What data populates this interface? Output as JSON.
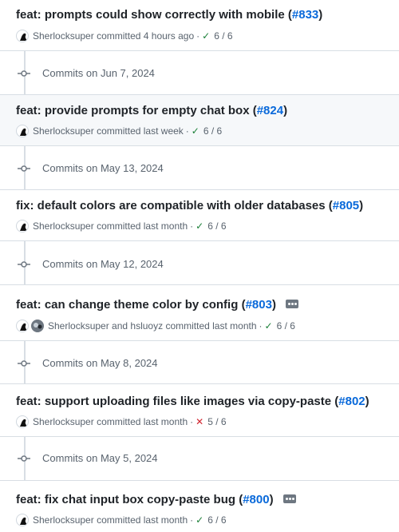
{
  "commits": [
    {
      "title": "feat: prompts could show correctly with mobile",
      "pr": "#833",
      "authors": "Sherlocksuper",
      "time": "4 hours ago",
      "status": "success",
      "checks": "6 / 6",
      "ellipsis": false
    },
    {
      "title": "feat: provide prompts for empty chat box",
      "pr": "#824",
      "authors": "Sherlocksuper",
      "time": "last week",
      "status": "success",
      "checks": "6 / 6",
      "ellipsis": false
    },
    {
      "title": "fix: default colors are compatible with older databases",
      "pr": "#805",
      "authors": "Sherlocksuper",
      "time": "last month",
      "status": "success",
      "checks": "6 / 6",
      "ellipsis": false
    },
    {
      "title": "feat: can change theme color by config",
      "pr": "#803",
      "authors": "Sherlocksuper and hsluoyz",
      "time": "last month",
      "status": "success",
      "checks": "6 / 6",
      "ellipsis": true
    },
    {
      "title": "feat: support uploading files like images via copy-paste",
      "pr": "#802",
      "authors": "Sherlocksuper",
      "time": "last month",
      "status": "failure",
      "checks": "5 / 6",
      "ellipsis": false
    },
    {
      "title": "feat: fix chat input box copy-paste bug",
      "pr": "#800",
      "authors": "Sherlocksuper",
      "time": "last month",
      "status": "success",
      "checks": "6 / 6",
      "ellipsis": true
    }
  ],
  "date_groups": [
    "Commits on Jun 7, 2024",
    "Commits on May 13, 2024",
    "Commits on May 12, 2024",
    "Commits on May 8, 2024",
    "Commits on May 5, 2024"
  ],
  "labels": {
    "committed": "committed",
    "separator": "·",
    "open_paren": "(",
    "close_paren": ")"
  },
  "icons": {
    "success": "check-icon",
    "failure": "x-icon",
    "commit_node": "git-commit-icon",
    "more": "ellipsis-icon"
  },
  "colors": {
    "link": "#0969da",
    "success": "#1a7f37",
    "failure": "#d1242f",
    "muted": "#59636e",
    "highlight_bg": "#f6f8fa",
    "border": "#d8dee4"
  }
}
